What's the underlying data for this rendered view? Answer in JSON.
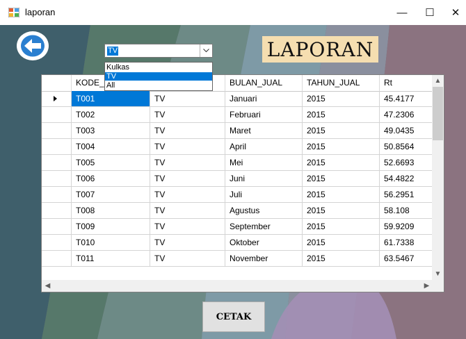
{
  "window": {
    "title": "laporan"
  },
  "controls": {
    "minimize": "—",
    "maximize": "☐",
    "close": "✕"
  },
  "filter": {
    "selected": "TV",
    "options": [
      "Kulkas",
      "TV",
      "All"
    ],
    "highlighted_index": 1
  },
  "header": {
    "title": "LAPORAN"
  },
  "table": {
    "columns": [
      "KODE_",
      "",
      "BULAN_JUAL",
      "TAHUN_JUAL",
      "Rt"
    ],
    "rows": [
      [
        "T001",
        "TV",
        "Januari",
        "2015",
        "45.4177"
      ],
      [
        "T002",
        "TV",
        "Februari",
        "2015",
        "47.2306"
      ],
      [
        "T003",
        "TV",
        "Maret",
        "2015",
        "49.0435"
      ],
      [
        "T004",
        "TV",
        "April",
        "2015",
        "50.8564"
      ],
      [
        "T005",
        "TV",
        "Mei",
        "2015",
        "52.6693"
      ],
      [
        "T006",
        "TV",
        "Juni",
        "2015",
        "54.4822"
      ],
      [
        "T007",
        "TV",
        "Juli",
        "2015",
        "56.2951"
      ],
      [
        "T008",
        "TV",
        "Agustus",
        "2015",
        "58.108"
      ],
      [
        "T009",
        "TV",
        "September",
        "2015",
        "59.9209"
      ],
      [
        "T010",
        "TV",
        "Oktober",
        "2015",
        "61.7338"
      ],
      [
        "T011",
        "TV",
        "November",
        "2015",
        "63.5467"
      ]
    ],
    "current_row": 0
  },
  "actions": {
    "print_label": "CETAK"
  },
  "colors": {
    "selection": "#0078d7",
    "title_bg": "#f5deb0",
    "button_bg": "#e1e1e1"
  }
}
